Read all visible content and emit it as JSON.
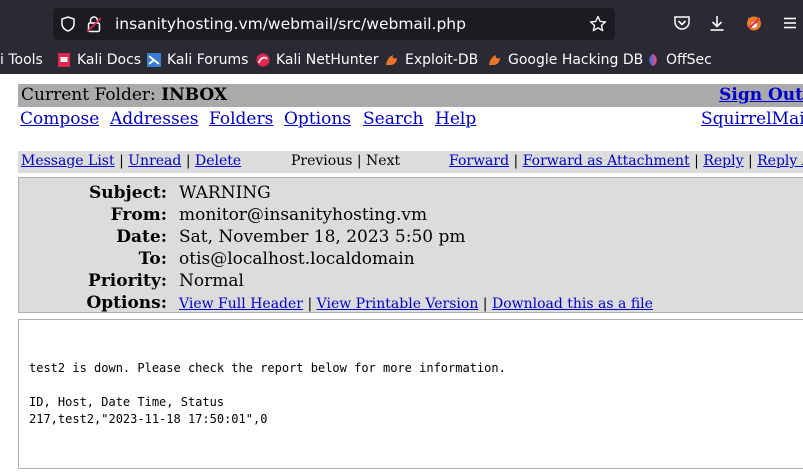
{
  "browser": {
    "url": "insanityhosting.vm/webmail/src/webmail.php",
    "bookmarks": [
      {
        "label": "i Tools",
        "icon": "kali-tools-icon"
      },
      {
        "label": "Kali Docs",
        "icon": "kali-docs-icon"
      },
      {
        "label": "Kali Forums",
        "icon": "kali-forums-icon"
      },
      {
        "label": "Kali NetHunter",
        "icon": "kali-nethunter-icon"
      },
      {
        "label": "Exploit-DB",
        "icon": "exploit-db-icon"
      },
      {
        "label": "Google Hacking DB",
        "icon": "google-hacking-db-icon"
      },
      {
        "label": "OffSec",
        "icon": "offsec-icon"
      }
    ]
  },
  "webmail": {
    "folder_label": "Current Folder:",
    "folder_name": "INBOX",
    "sign_out": "Sign Out",
    "menu": [
      "Compose",
      "Addresses",
      "Folders",
      "Options",
      "Search",
      "Help"
    ],
    "brand_link": "SquirrelMail",
    "nav": {
      "message_list": "Message List",
      "unread": "Unread",
      "delete": "Delete",
      "previous": "Previous",
      "next": "Next",
      "forward": "Forward",
      "forward_attachment": "Forward as Attachment",
      "reply": "Reply",
      "reply_all": "Reply All",
      "separator": "|"
    },
    "headers": {
      "subject_label": "Subject:",
      "subject": "WARNING",
      "from_label": "From:",
      "from": "monitor@insanityhosting.vm",
      "date_label": "Date:",
      "date": "Sat, November 18, 2023 5:50 pm",
      "to_label": "To:",
      "to": "otis@localhost.localdomain",
      "priority_label": "Priority:",
      "priority": "Normal",
      "options_label": "Options:",
      "view_full_header": "View Full Header",
      "view_printable": "View Printable Version",
      "download": "Download this as a file"
    },
    "body": "test2 is down. Please check the report below for more information.\n\nID, Host, Date Time, Status\n217,test2,\"2023-11-18 17:50:01\",0"
  }
}
